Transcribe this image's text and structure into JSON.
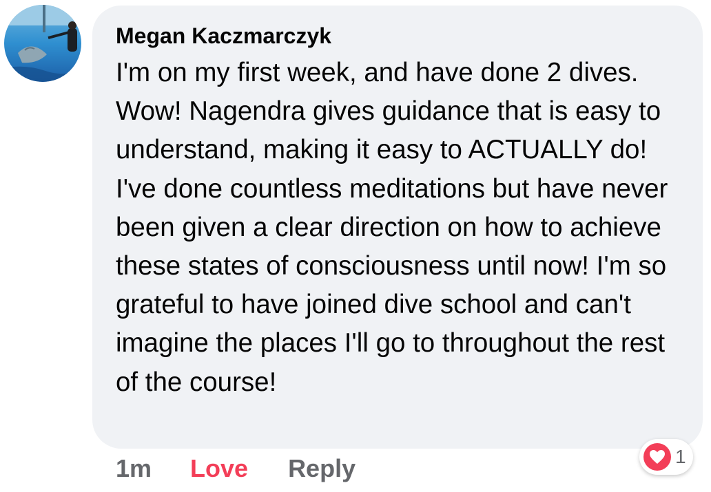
{
  "comment": {
    "author": "Megan Kaczmarczyk",
    "text": "I'm on my first week, and have done 2 dives. Wow! Nagendra gives guidance that is easy to understand, making it easy to ACTUALLY do! I've done countless meditations but have never been given a clear direction on how to achieve these states of consciousness until now! I'm so grateful to have joined dive school and can't imagine the places I'll go to throughout the rest of the course!",
    "timestamp": "1m",
    "love_label": "Love",
    "reply_label": "Reply",
    "reaction_icon": "heart-icon",
    "reaction_count": "1"
  },
  "colors": {
    "bubble_bg": "#f0f2f5",
    "love_accent": "#f33e58",
    "secondary_text": "#65676b",
    "primary_text": "#050505"
  }
}
